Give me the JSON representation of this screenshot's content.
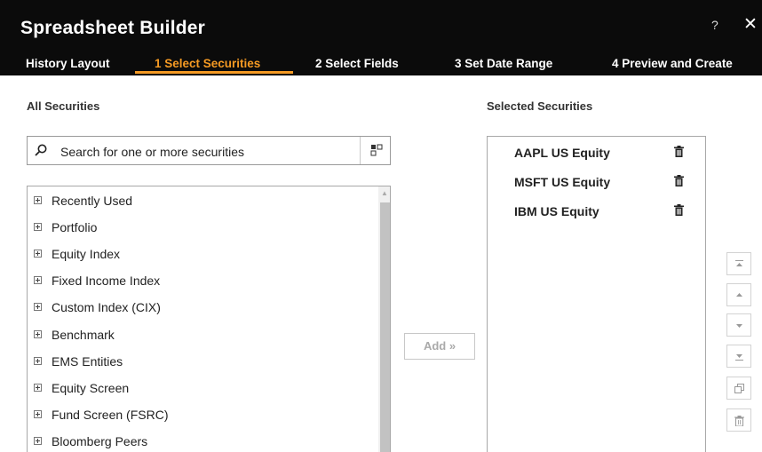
{
  "window": {
    "title": "Spreadsheet Builder",
    "help_label": "?",
    "close_label": "✕"
  },
  "steps": [
    {
      "label": "History Layout",
      "active": false
    },
    {
      "label": "1 Select Securities",
      "active": true
    },
    {
      "label": "2 Select Fields",
      "active": false
    },
    {
      "label": "3 Set Date Range",
      "active": false
    },
    {
      "label": "4 Preview and Create",
      "active": false
    }
  ],
  "all_securities": {
    "heading": "All Securities",
    "search_placeholder": "Search for one or more securities",
    "tree_items": [
      "Recently Used",
      "Portfolio",
      "Equity Index",
      "Fixed Income Index",
      "Custom Index (CIX)",
      "Benchmark",
      "EMS Entities",
      "Equity Screen",
      "Fund Screen (FSRC)",
      "Bloomberg Peers"
    ]
  },
  "add_button": {
    "label": "Add »"
  },
  "selected_securities": {
    "heading": "Selected Securities",
    "items": [
      "AAPL US Equity",
      "MSFT US Equity",
      "IBM US Equity"
    ]
  },
  "side_buttons": [
    "move-to-top-icon",
    "move-up-icon",
    "move-down-icon",
    "move-to-bottom-icon",
    "copy-icon",
    "delete-icon"
  ],
  "colors": {
    "titlebar": "#0b0b0b",
    "accent": "#f59a23",
    "text": "#222222"
  }
}
